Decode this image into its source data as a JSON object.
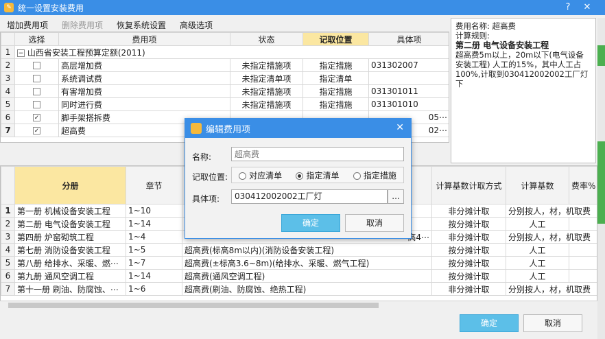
{
  "window": {
    "title": "统一设置安装费用",
    "help": "?",
    "close": "✕"
  },
  "menu": {
    "add": "增加费用项",
    "delete": "删除费用项",
    "restore": "恢复系统设置",
    "advanced": "高级选项"
  },
  "top_table": {
    "headers": [
      "选择",
      "费用项",
      "状态",
      "记取位置",
      "具体项"
    ],
    "group": {
      "num": "1",
      "toggle": "−",
      "label": "山西省安装工程预算定额(2011)"
    },
    "rows": [
      {
        "num": "2",
        "checked": "",
        "name": "高层增加费",
        "status": "未指定措施项",
        "pos": "指定措施",
        "item": "031302007"
      },
      {
        "num": "3",
        "checked": "",
        "name": "系统调试费",
        "status": "未指定清单项",
        "pos": "指定清单",
        "item": ""
      },
      {
        "num": "4",
        "checked": "",
        "name": "有害增加费",
        "status": "未指定措施项",
        "pos": "指定措施",
        "item": "031301011"
      },
      {
        "num": "5",
        "checked": "",
        "name": "同时进行费",
        "status": "未指定措施项",
        "pos": "指定措施",
        "item": "031301010"
      },
      {
        "num": "6",
        "checked": "✓",
        "name": "脚手架搭拆费",
        "status": "",
        "pos": "",
        "item": "05⋯"
      },
      {
        "num": "7",
        "checked": "✓",
        "name": "超高费",
        "status": "",
        "pos": "",
        "item": "02⋯"
      }
    ]
  },
  "info": {
    "name_line": "费用名称: 超高费",
    "rule_label": "计算规则:",
    "section": "第二册 电气设备安装工程",
    "desc": "超高费5m以上，20m以下(电气设备安装工程) 人工的15%，其中人工占100%,计取到030412002002工厂灯下"
  },
  "bottom_table": {
    "headers": [
      "分册",
      "章节",
      "",
      "计算基数计取方式",
      "计算基数",
      "费率%"
    ],
    "rows": [
      {
        "num": "1",
        "book": "第一册 机械设备安装工程",
        "chapter": "1~10",
        "desc": "",
        "mode": "非分摊计取",
        "base": "分别按人，材，机取费",
        "rate": ""
      },
      {
        "num": "2",
        "book": "第二册 电气设备安装工程",
        "chapter": "1~14",
        "desc": "",
        "mode": "按分摊计取",
        "base": "人工",
        "rate": ""
      },
      {
        "num": "3",
        "book": "第四册 炉窑砌筑工程",
        "chapter": "1~4",
        "desc": "高4⋯",
        "mode": "非分摊计取",
        "base": "分别按人，材，机取费",
        "rate": ""
      },
      {
        "num": "4",
        "book": "第七册 消防设备安装工程",
        "chapter": "1~5",
        "desc": "超高费(标高8m以内)(消防设备安装工程)",
        "mode": "按分摊计取",
        "base": "人工",
        "rate": ""
      },
      {
        "num": "5",
        "book": "第八册 给排水、采暖、燃⋯",
        "chapter": "1~7",
        "desc": "超高费(±标高3.6~8m)(给排水、采暖、燃气工程)",
        "mode": "按分摊计取",
        "base": "人工",
        "rate": ""
      },
      {
        "num": "6",
        "book": "第九册 通风空调工程",
        "chapter": "1~14",
        "desc": "超高费(通风空调工程)",
        "mode": "按分摊计取",
        "base": "人工",
        "rate": ""
      },
      {
        "num": "7",
        "book": "第十一册 刷油、防腐蚀、⋯",
        "chapter": "1~6",
        "desc": "超高费(刷油、防腐蚀、绝热工程)",
        "mode": "非分摊计取",
        "base": "分别按人，材，机取费",
        "rate": ""
      }
    ]
  },
  "dialog": {
    "title": "编辑费用项",
    "close": "✕",
    "name_label": "名称:",
    "name_placeholder": "超高费",
    "pos_label": "记取位置:",
    "opt1": "对应清单",
    "opt2": "指定清单",
    "opt3": "指定措施",
    "item_label": "具体项:",
    "item_value": "030412002002工厂灯",
    "browse": "...",
    "ok": "确定",
    "cancel": "取消"
  },
  "footer": {
    "ok": "确定",
    "cancel": "取消"
  },
  "colors": {
    "title": "#3a8ee6",
    "accent": "#5cbfe8",
    "header_sel": "#fbe7a1"
  }
}
